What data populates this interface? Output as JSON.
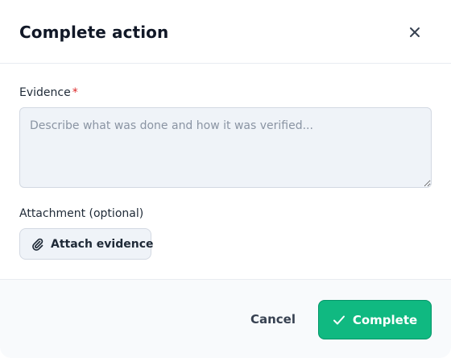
{
  "dialog": {
    "title": "Complete action",
    "close_icon": "close-icon"
  },
  "evidence": {
    "label": "Evidence",
    "required_marker": "*",
    "value": "",
    "placeholder": "Describe what was done and how it was verified..."
  },
  "attachment": {
    "label": "Attachment (optional)",
    "button_label": "Attach evidence",
    "button_icon": "paperclip-icon"
  },
  "footer": {
    "cancel_label": "Cancel",
    "complete_label": "Complete",
    "complete_icon": "check-icon"
  },
  "colors": {
    "primary": "#10b981",
    "required": "#dc2626",
    "input_bg": "#eff3f8",
    "footer_bg": "#f8fafc"
  }
}
